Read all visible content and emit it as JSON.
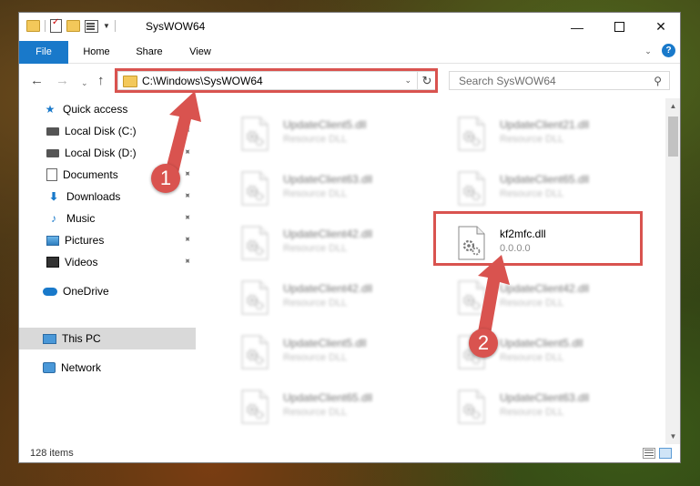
{
  "window": {
    "title": "SysWOW64",
    "minimize_glyph": "—",
    "close_glyph": "✕"
  },
  "ribbon": {
    "tabs": [
      {
        "label": "File"
      },
      {
        "label": "Home"
      },
      {
        "label": "Share"
      },
      {
        "label": "View"
      }
    ],
    "expand_glyph": "⌄",
    "help_glyph": "?"
  },
  "nav": {
    "back_glyph": "←",
    "forward_glyph": "→",
    "recent_glyph": "⌄",
    "up_glyph": "↑",
    "address": "C:\\Windows\\SysWOW64",
    "address_drop_glyph": "⌄",
    "refresh_glyph": "↻",
    "search_placeholder": "Search SysWOW64",
    "search_glyph": "⚲"
  },
  "sidebar": {
    "items": [
      {
        "label": "Quick access",
        "icon": "quick-access-star-icon",
        "pinned": false
      },
      {
        "label": "Local Disk (C:)",
        "icon": "local-disk-icon",
        "pinned": true
      },
      {
        "label": "Local Disk (D:)",
        "icon": "local-disk-icon",
        "pinned": true
      },
      {
        "label": "Documents",
        "icon": "documents-icon",
        "pinned": true
      },
      {
        "label": "Downloads",
        "icon": "downloads-icon",
        "pinned": true
      },
      {
        "label": "Music",
        "icon": "music-icon",
        "pinned": true
      },
      {
        "label": "Pictures",
        "icon": "pictures-icon",
        "pinned": true
      },
      {
        "label": "Videos",
        "icon": "videos-icon",
        "pinned": true
      },
      {
        "label": "OneDrive",
        "icon": "onedrive-icon",
        "pinned": false
      },
      {
        "label": "This PC",
        "icon": "this-pc-icon",
        "pinned": false,
        "selected": true
      },
      {
        "label": "Network",
        "icon": "network-icon",
        "pinned": false
      }
    ],
    "pin_glyph": "📌",
    "star_glyph": "★",
    "down_glyph": "⬇",
    "music_glyph": "♪"
  },
  "files": [
    {
      "name": "UpdateClient5.dll",
      "type": "Resource DLL",
      "blurred": true
    },
    {
      "name": "UpdateClient21.dll",
      "type": "Resource DLL",
      "blurred": true
    },
    {
      "name": "UpdateClient63.dll",
      "type": "Resource DLL",
      "blurred": true
    },
    {
      "name": "UpdateClient65.dll",
      "type": "Resource DLL",
      "blurred": true
    },
    {
      "name": "UpdateClient42.dll",
      "type": "Resource DLL",
      "blurred": true
    },
    {
      "name": "kf2mfc.dll",
      "type": "0.0.0.0",
      "sub": "-",
      "blurred": false
    },
    {
      "name": "UpdateClient42.dll",
      "type": "Resource DLL",
      "blurred": true
    },
    {
      "name": "UpdateClient42.dll",
      "type": "Resource DLL",
      "blurred": true
    },
    {
      "name": "UpdateClient5.dll",
      "type": "Resource DLL",
      "blurred": true
    },
    {
      "name": "UpdateClient5.dll",
      "type": "Resource DLL",
      "blurred": true
    },
    {
      "name": "UpdateClient65.dll",
      "type": "Resource DLL",
      "blurred": true
    },
    {
      "name": "UpdateClient63.dll",
      "type": "Resource DLL",
      "blurred": true
    }
  ],
  "scroll": {
    "up_glyph": "▲",
    "down_glyph": "▼"
  },
  "status": {
    "item_count": "128 items"
  },
  "annotations": {
    "marker1": "1",
    "marker2": "2",
    "color": "#d9534f"
  },
  "colors": {
    "accent": "#1979ca",
    "selection": "#d9d9d9"
  }
}
